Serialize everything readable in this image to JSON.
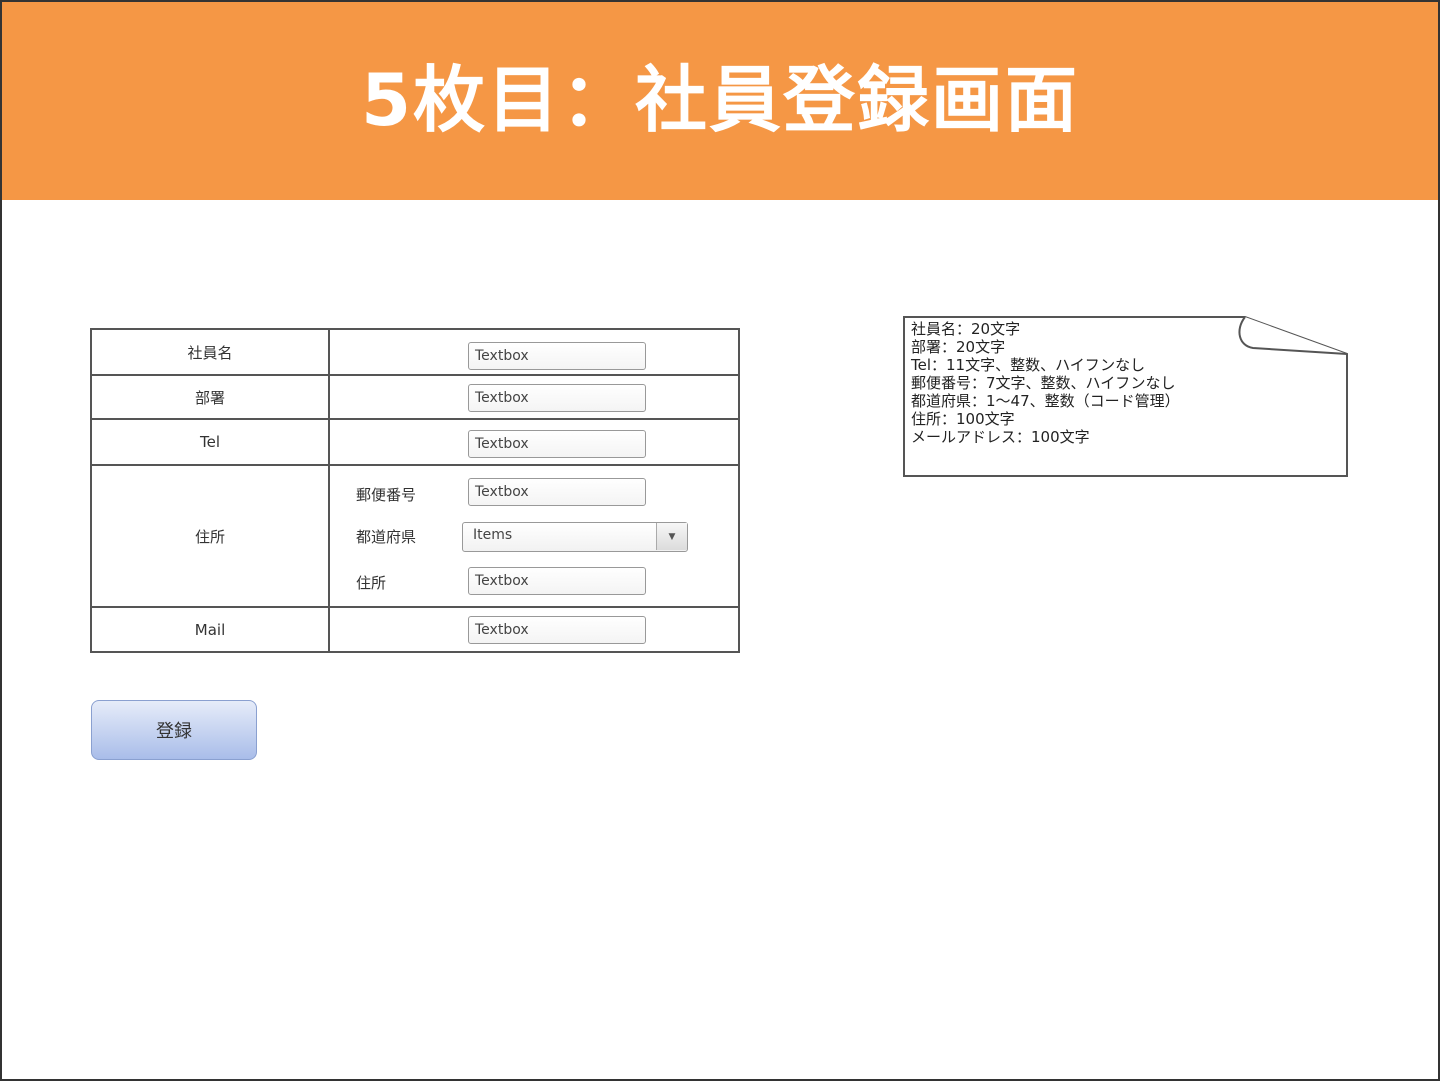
{
  "slide": {
    "title": "5枚目：社員登録画面"
  },
  "form": {
    "rows": {
      "employee_name": {
        "label": "社員名",
        "value": "Textbox"
      },
      "department": {
        "label": "部署",
        "value": "Textbox"
      },
      "tel": {
        "label": "Tel",
        "value": "Textbox"
      },
      "address": {
        "label": "住所",
        "postal_code": {
          "label": "郵便番号",
          "value": "Textbox"
        },
        "prefecture": {
          "label": "都道府県",
          "value": "Items"
        },
        "street": {
          "label": "住所",
          "value": "Textbox"
        }
      },
      "mail": {
        "label": "Mail",
        "value": "Textbox"
      }
    },
    "submit_label": "登録"
  },
  "note": {
    "lines": [
      "社員名：20文字",
      "部署：20文字",
      "Tel：11文字、整数、ハイフンなし",
      "郵便番号：7文字、整数、ハイフンなし",
      "都道府県：1～47、整数（コード管理）",
      "住所：100文字",
      "メールアドレス：100文字"
    ]
  },
  "colors": {
    "banner": "#f59745",
    "button_top": "#e6ecf9",
    "button_bottom": "#a9bde9"
  },
  "icons": {
    "dropdown": "triangle-down"
  }
}
